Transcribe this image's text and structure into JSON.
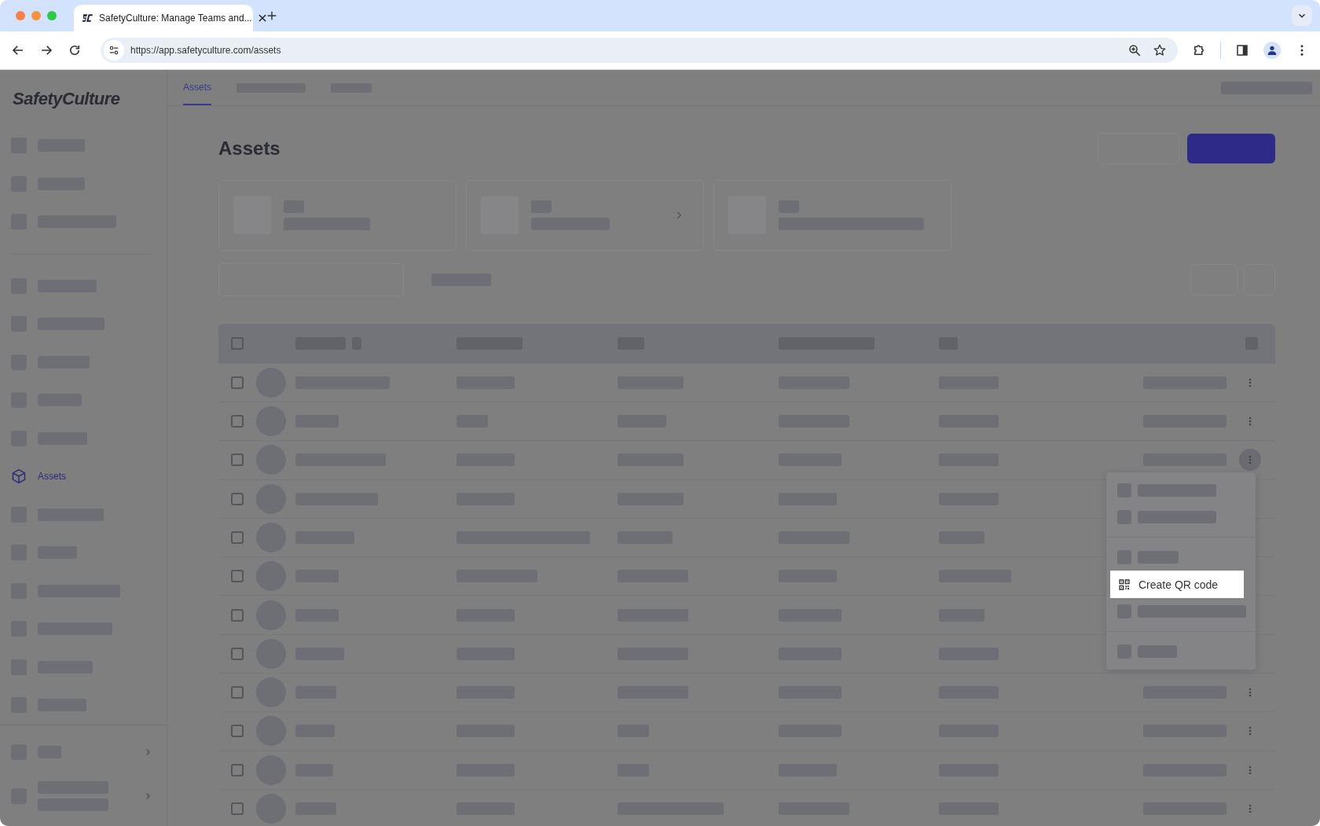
{
  "browser": {
    "tab_title": "SafetyCulture: Manage Teams and...",
    "url": "https://app.safetyculture.com/assets"
  },
  "app": {
    "logo": "SafetyCulture",
    "sidebar_current_item": "Assets",
    "top_tabs": [
      {
        "label": "Assets",
        "selected": true
      }
    ],
    "page_title": "Assets"
  },
  "table": {
    "header_checked": false,
    "rows": [
      {
        "checked": false
      },
      {
        "checked": false
      },
      {
        "checked": false
      },
      {
        "checked": false
      },
      {
        "checked": false
      },
      {
        "checked": false
      },
      {
        "checked": false
      },
      {
        "checked": false
      },
      {
        "checked": false
      },
      {
        "checked": false
      },
      {
        "checked": false
      },
      {
        "checked": false
      }
    ]
  },
  "row_menu": {
    "highlighted_item": "Create QR code"
  }
}
